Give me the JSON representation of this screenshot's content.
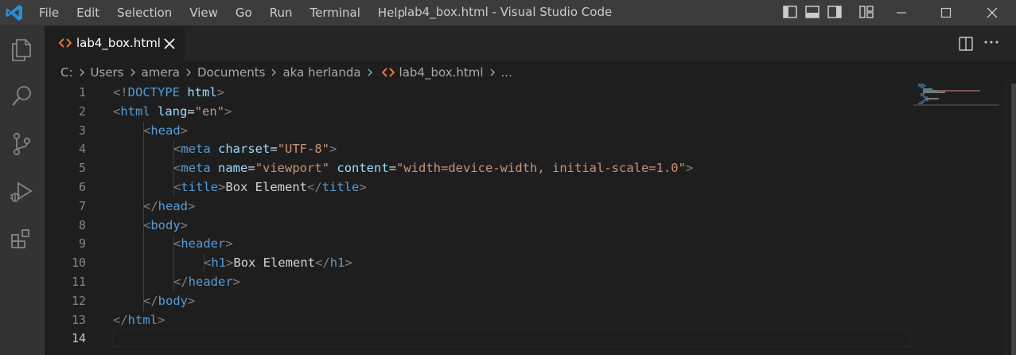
{
  "titlebar": {
    "title": "lab4_box.html - Visual Studio Code",
    "menu": [
      "File",
      "Edit",
      "Selection",
      "View",
      "Go",
      "Run",
      "Terminal",
      "Help"
    ],
    "layout_icons": [
      "toggle-primary-sidebar-icon",
      "toggle-panel-icon",
      "toggle-secondary-sidebar-icon",
      "customize-layout-icon"
    ],
    "window_controls": [
      "minimize-icon",
      "maximize-icon",
      "close-icon"
    ]
  },
  "activitybar": {
    "icons": [
      "explorer-icon",
      "search-icon",
      "source-control-icon",
      "run-debug-icon",
      "extensions-icon"
    ]
  },
  "tab": {
    "label": "lab4_box.html",
    "icon": "html-file-icon",
    "close_icon": "close-icon"
  },
  "breadcrumb": [
    "C:",
    "Users",
    "amera",
    "Documents",
    "aka herlanda",
    "lab4_box.html",
    "..."
  ],
  "editor": {
    "line_numbers": [
      "1",
      "2",
      "3",
      "4",
      "5",
      "6",
      "7",
      "8",
      "9",
      "10",
      "11",
      "12",
      "13",
      "14"
    ],
    "active_line": "14"
  },
  "colors": {
    "accent": "#0078d4",
    "tag": "#569cd6",
    "attribute": "#9cdcfe",
    "string": "#ce9178",
    "punctuation": "#808080",
    "html_icon": "#e37933"
  },
  "code": {
    "l1": {
      "b1": "<!",
      "t1": "DOCTYPE",
      "a1": "html",
      "b2": ">"
    },
    "l2": {
      "b1": "<",
      "t1": "html",
      "a1": "lang",
      "eq": "=",
      "s1": "\"en\"",
      "b2": ">"
    },
    "l3": {
      "b1": "<",
      "t1": "head",
      "b2": ">"
    },
    "l4": {
      "b1": "<",
      "t1": "meta",
      "a1": "charset",
      "eq": "=",
      "s1": "\"UTF-8\"",
      "b2": ">"
    },
    "l5": {
      "b1": "<",
      "t1": "meta",
      "a1": "name",
      "eq1": "=",
      "s1": "\"viewport\"",
      "a2": "content",
      "eq2": "=",
      "s2": "\"width=device-width, initial-scale=1.0\"",
      "b2": ">"
    },
    "l6": {
      "b1": "<",
      "t1": "title",
      "b2": ">",
      "txt": "Box Element",
      "b3": "</",
      "t2": "title",
      "b4": ">"
    },
    "l7": {
      "b1": "</",
      "t1": "head",
      "b2": ">"
    },
    "l8": {
      "b1": "<",
      "t1": "body",
      "b2": ">"
    },
    "l9": {
      "b1": "<",
      "t1": "header",
      "b2": ">"
    },
    "l10": {
      "b1": "<",
      "t1": "h1",
      "b2": ">",
      "txt": "Box Element",
      "b3": "</",
      "t2": "h1",
      "b4": ">"
    },
    "l11": {
      "b1": "</",
      "t1": "header",
      "b2": ">"
    },
    "l12": {
      "b1": "</",
      "t1": "body",
      "b2": ">"
    },
    "l13": {
      "b1": "</",
      "t1": "html",
      "b2": ">"
    }
  }
}
